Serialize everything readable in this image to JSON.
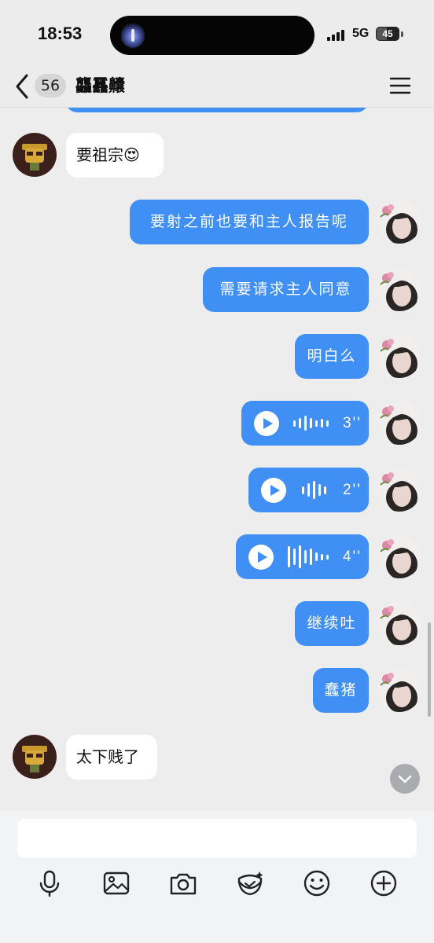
{
  "status_bar": {
    "time": "18:53",
    "network": "5G",
    "battery": "45",
    "icons": [
      "flashlight-icon",
      "signal-icon",
      "battery-icon"
    ]
  },
  "header": {
    "back_icon": "chevron-left-icon",
    "unread_count": "56",
    "title": "龘靐齉",
    "menu_icon": "hamburger-menu-icon"
  },
  "messages": [
    {
      "side": "theirs",
      "type": "text",
      "text": "要祖宗😍"
    },
    {
      "side": "mine",
      "type": "text",
      "text": "要射之前也要和主人报告呢"
    },
    {
      "side": "mine",
      "type": "text",
      "text": "需要请求主人同意"
    },
    {
      "side": "mine",
      "type": "text",
      "text": "明白么"
    },
    {
      "side": "mine",
      "type": "voice",
      "duration": "3''"
    },
    {
      "side": "mine",
      "type": "voice",
      "duration": "2''"
    },
    {
      "side": "mine",
      "type": "voice",
      "duration": "4''"
    },
    {
      "side": "mine",
      "type": "text",
      "text": "继续吐"
    },
    {
      "side": "mine",
      "type": "text",
      "text": "蠢猪"
    },
    {
      "side": "theirs",
      "type": "text",
      "text": "太下贱了"
    }
  ],
  "input": {
    "value": "",
    "placeholder": ""
  },
  "toolbar": [
    "microphone-icon",
    "image-icon",
    "camera-icon",
    "red-packet-icon",
    "emoji-icon",
    "plus-icon"
  ],
  "colors": {
    "bubble_mine": "#3f8ff5",
    "bubble_theirs": "#ffffff",
    "background": "#ededed"
  }
}
